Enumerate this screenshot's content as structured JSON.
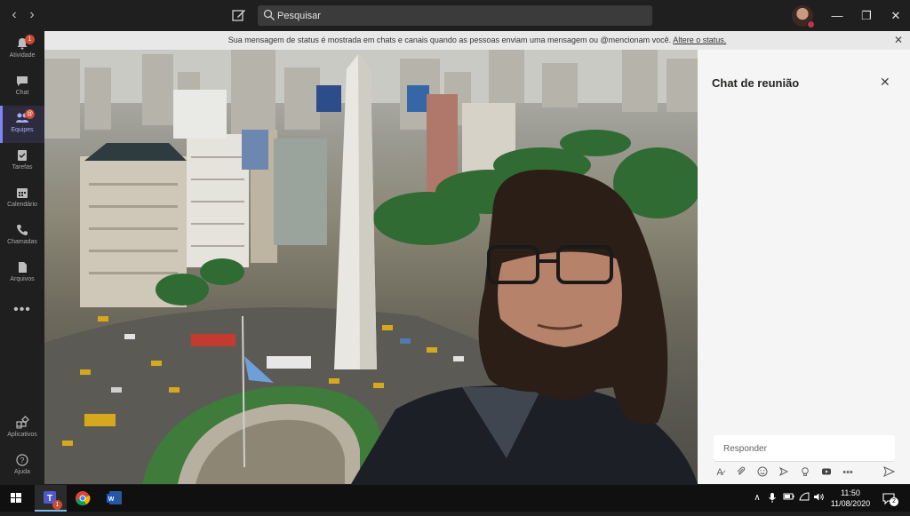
{
  "titlebar": {
    "search_placeholder": "Pesquisar",
    "back_icon": "chevron-left-icon",
    "forward_icon": "chevron-right-icon",
    "compose_icon": "compose-icon",
    "minimize": "—",
    "restore": "❐",
    "close": "✕"
  },
  "rail": {
    "items": [
      {
        "label": "Atividade",
        "icon": "bell-icon",
        "badge": "1"
      },
      {
        "label": "Chat",
        "icon": "chat-icon"
      },
      {
        "label": "Equipes",
        "icon": "teams-icon",
        "badge": "@"
      },
      {
        "label": "Tarefas",
        "icon": "tasks-icon"
      },
      {
        "label": "Calendário",
        "icon": "calendar-icon"
      },
      {
        "label": "Chamadas",
        "icon": "phone-icon"
      },
      {
        "label": "Arquivos",
        "icon": "file-icon"
      }
    ],
    "more": "•••",
    "apps_label": "Aplicativos",
    "help_label": "Ajuda"
  },
  "banner": {
    "text": "Sua mensagem de status é mostrada em chats e canais quando as pessoas enviam uma mensagem ou @mencionam você.",
    "link": "Altere o status."
  },
  "chat": {
    "title": "Chat de reunião",
    "reply_placeholder": "Responder"
  },
  "taskbar": {
    "time": "11:50",
    "date": "11/08/2020",
    "notifications": "2",
    "teams_badge": "1"
  },
  "colors": {
    "accent": "#7f85f5",
    "badge": "#cc4a31",
    "rail_bg": "#1f1f1f"
  }
}
